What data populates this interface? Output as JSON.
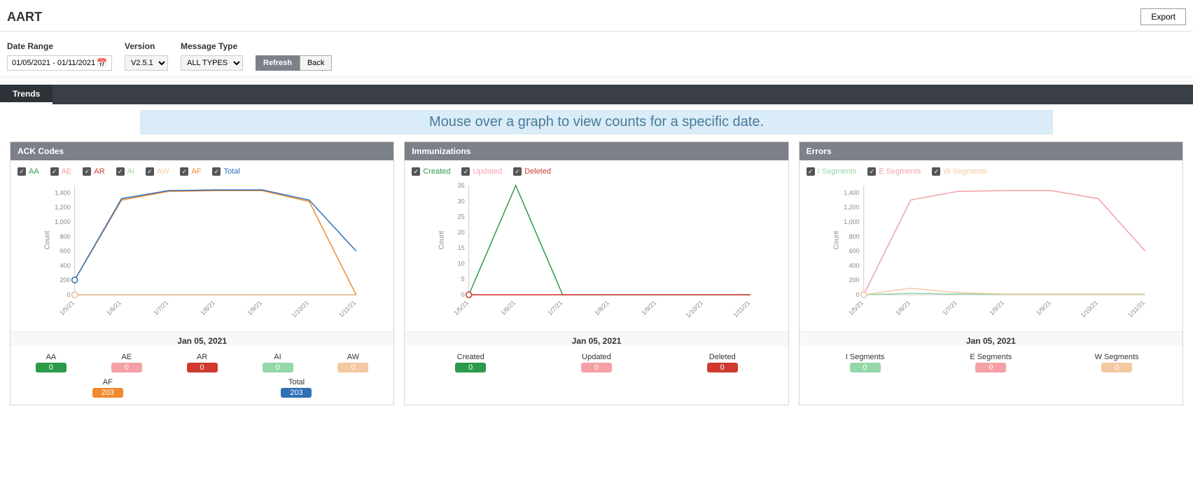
{
  "header": {
    "title": "AART",
    "export_label": "Export"
  },
  "filters": {
    "date_label": "Date Range",
    "date_value": "01/05/2021 - 01/11/2021",
    "version_label": "Version",
    "version_value": "V2.5.1",
    "msgtype_label": "Message Type",
    "msgtype_value": "ALL TYPES",
    "refresh_label": "Refresh",
    "back_label": "Back"
  },
  "tab": {
    "label": "Trends"
  },
  "banner": "Mouse over a graph to view counts for a specific date.",
  "colors": {
    "aa": "#2c9a4a",
    "ae": "#f4a0a6",
    "ar": "#d03a2e",
    "ai": "#94d7a8",
    "aw": "#f4c9a2",
    "af": "#f08a2f",
    "total": "#2f6fb5",
    "created": "#2c9a4a",
    "updated": "#f4a0a6",
    "deleted": "#d03a2e",
    "iseg": "#94d7a8",
    "eseg": "#f4a0a6",
    "wseg": "#f4c9a2"
  },
  "date_caption": "Jan 05, 2021",
  "chart_data": [
    {
      "name": "ack",
      "title": "ACK Codes",
      "type": "line",
      "categories": [
        "1/5/21",
        "1/6/21",
        "1/7/21",
        "1/8/21",
        "1/9/21",
        "1/10/21",
        "1/11/21"
      ],
      "ylabel": "Count",
      "ylim": [
        0,
        1500
      ],
      "yticks": [
        0,
        200,
        400,
        600,
        800,
        1000,
        1200,
        1400
      ],
      "series": [
        {
          "name": "AA",
          "color": "aa",
          "values": [
            0,
            0,
            0,
            0,
            0,
            0,
            0
          ]
        },
        {
          "name": "AE",
          "color": "ae",
          "values": [
            0,
            0,
            0,
            0,
            0,
            0,
            0
          ]
        },
        {
          "name": "AR",
          "color": "ar",
          "values": [
            0,
            0,
            0,
            0,
            0,
            0,
            0
          ]
        },
        {
          "name": "AI",
          "color": "ai",
          "values": [
            0,
            0,
            0,
            0,
            0,
            0,
            0
          ]
        },
        {
          "name": "AW",
          "color": "aw",
          "values": [
            0,
            0,
            0,
            0,
            0,
            0,
            0
          ]
        },
        {
          "name": "AF",
          "color": "af",
          "values": [
            203,
            1300,
            1420,
            1430,
            1430,
            1280,
            0
          ]
        },
        {
          "name": "Total",
          "color": "total",
          "values": [
            203,
            1320,
            1430,
            1440,
            1440,
            1300,
            600
          ]
        }
      ],
      "marker_index": 0,
      "legend": [
        {
          "label": "AA",
          "color": "aa"
        },
        {
          "label": "AE",
          "color": "ae"
        },
        {
          "label": "AR",
          "color": "ar"
        },
        {
          "label": "AI",
          "color": "ai"
        },
        {
          "label": "AW",
          "color": "aw"
        },
        {
          "label": "AF",
          "color": "af"
        },
        {
          "label": "Total",
          "color": "total"
        }
      ],
      "stats": [
        {
          "label": "AA",
          "value": "0",
          "color": "aa"
        },
        {
          "label": "AE",
          "value": "0",
          "color": "ae"
        },
        {
          "label": "AR",
          "value": "0",
          "color": "ar"
        },
        {
          "label": "AI",
          "value": "0",
          "color": "ai"
        },
        {
          "label": "AW",
          "value": "0",
          "color": "aw"
        },
        {
          "label": "AF",
          "value": "203",
          "color": "af"
        },
        {
          "label": "Total",
          "value": "203",
          "color": "total"
        }
      ]
    },
    {
      "name": "imm",
      "title": "Immunizations",
      "type": "line",
      "categories": [
        "1/5/21",
        "1/6/21",
        "1/7/21",
        "1/8/21",
        "1/9/21",
        "1/10/21",
        "1/11/21"
      ],
      "ylabel": "Count",
      "ylim": [
        0,
        35
      ],
      "yticks": [
        0,
        5,
        10,
        15,
        20,
        25,
        30,
        35
      ],
      "series": [
        {
          "name": "Created",
          "color": "created",
          "values": [
            0,
            35,
            0,
            0,
            0,
            0,
            0
          ]
        },
        {
          "name": "Updated",
          "color": "updated",
          "values": [
            0,
            0,
            0,
            0,
            0,
            0,
            0
          ]
        },
        {
          "name": "Deleted",
          "color": "deleted",
          "values": [
            0,
            0,
            0,
            0,
            0,
            0,
            0
          ]
        }
      ],
      "marker_index": 0,
      "legend": [
        {
          "label": "Created",
          "color": "created"
        },
        {
          "label": "Updated",
          "color": "updated"
        },
        {
          "label": "Deleted",
          "color": "deleted"
        }
      ],
      "stats": [
        {
          "label": "Created",
          "value": "0",
          "color": "created"
        },
        {
          "label": "Updated",
          "value": "0",
          "color": "updated"
        },
        {
          "label": "Deleted",
          "value": "0",
          "color": "deleted"
        }
      ]
    },
    {
      "name": "err",
      "title": "Errors",
      "type": "line",
      "categories": [
        "1/5/21",
        "1/6/21",
        "1/7/21",
        "1/8/21",
        "1/9/21",
        "1/10/21",
        "1/11/21"
      ],
      "ylabel": "Count",
      "ylim": [
        0,
        1500
      ],
      "yticks": [
        0,
        200,
        400,
        600,
        800,
        1000,
        1200,
        1400
      ],
      "series": [
        {
          "name": "I Segments",
          "color": "iseg",
          "values": [
            0,
            20,
            10,
            5,
            5,
            5,
            5
          ]
        },
        {
          "name": "E Segments",
          "color": "eseg",
          "values": [
            0,
            1300,
            1420,
            1430,
            1430,
            1320,
            600
          ]
        },
        {
          "name": "W Segments",
          "color": "wseg",
          "values": [
            0,
            90,
            30,
            10,
            10,
            10,
            10
          ]
        }
      ],
      "marker_index": 0,
      "legend": [
        {
          "label": "I Segments",
          "color": "iseg"
        },
        {
          "label": "E Segments",
          "color": "eseg"
        },
        {
          "label": "W Segments",
          "color": "wseg"
        }
      ],
      "stats": [
        {
          "label": "I Segments",
          "value": "0",
          "color": "iseg"
        },
        {
          "label": "E Segments",
          "value": "0",
          "color": "eseg"
        },
        {
          "label": "W Segments",
          "value": "0",
          "color": "wseg"
        }
      ]
    }
  ]
}
